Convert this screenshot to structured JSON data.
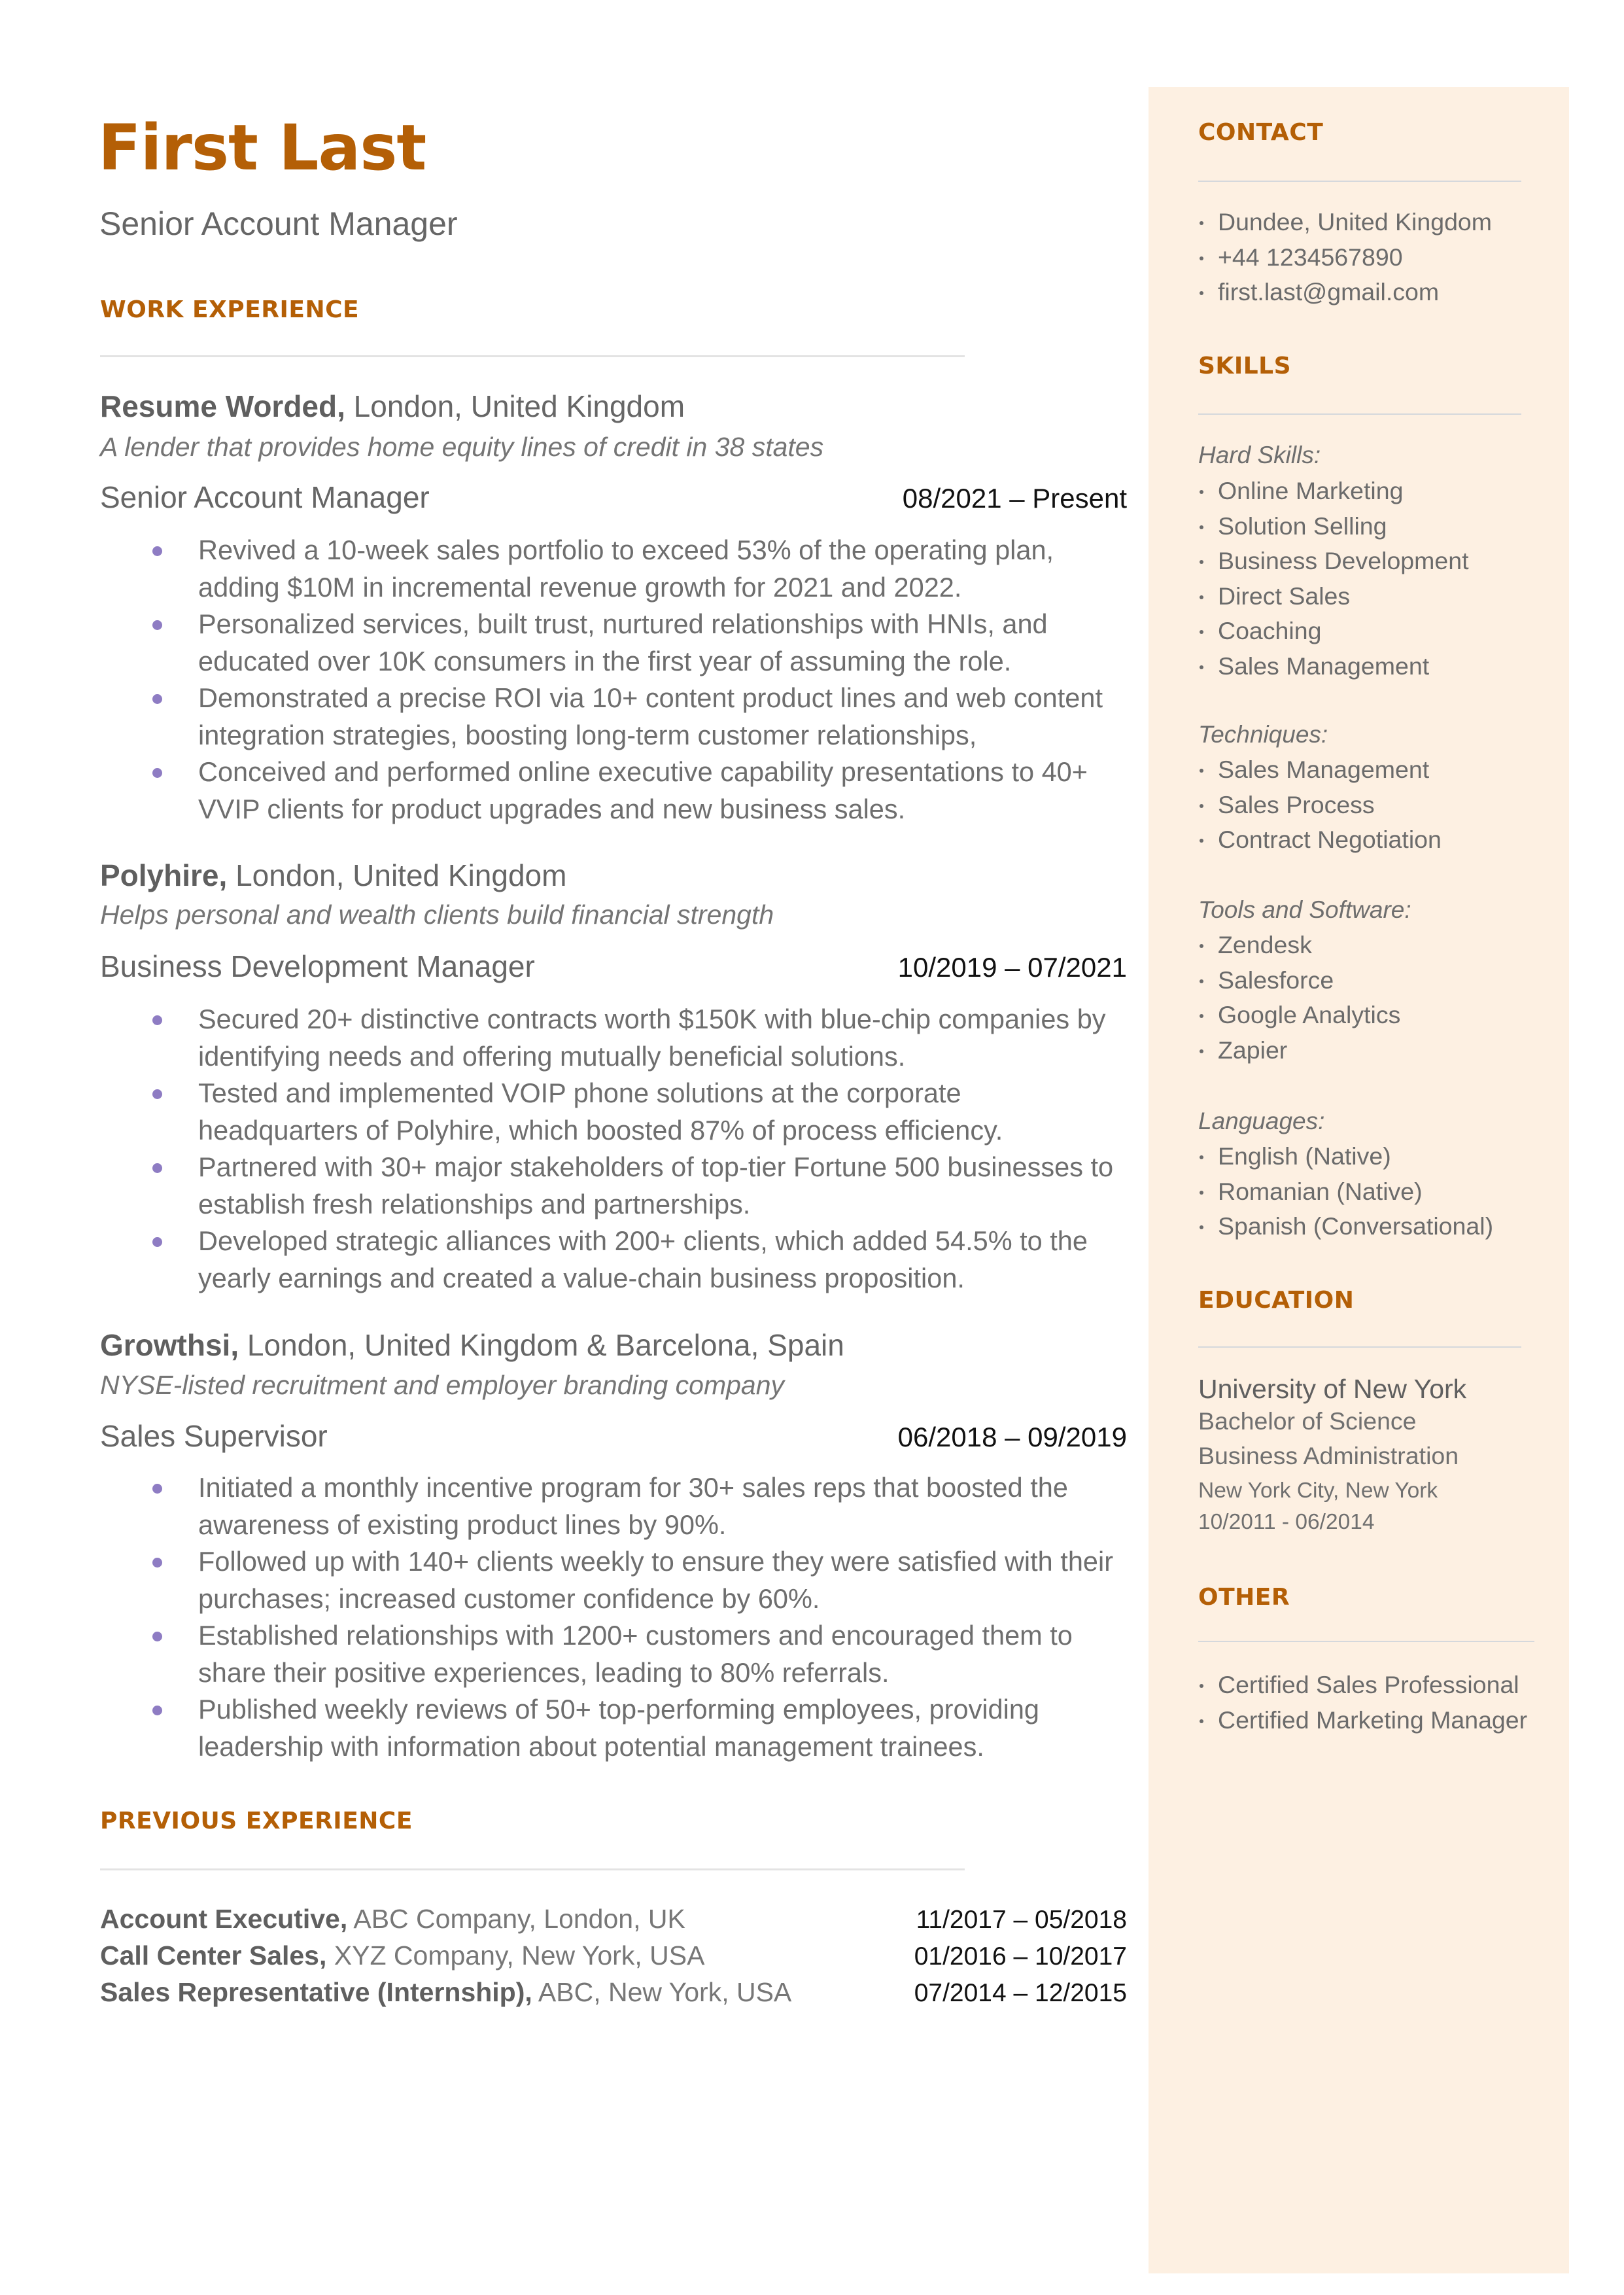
{
  "header": {
    "name": "First Last",
    "title": "Senior Account Manager"
  },
  "colors": {
    "accent": "#b45f06",
    "bullet": "#8e7cc3",
    "sidebar_bg": "#fdf0e2",
    "text": "#666666"
  },
  "work_experience": {
    "heading": "WORK EXPERIENCE",
    "jobs": [
      {
        "company": "Resume Worded,",
        "location": " London, United Kingdom",
        "tagline": "A lender that provides home equity lines of credit in 38 states",
        "role": "Senior Account Manager",
        "dates": "08/2021 – Present",
        "bullets": [
          "Revived a 10-week sales portfolio to exceed 53% of the operating plan, adding $10M in incremental revenue growth for 2021 and 2022.",
          "Personalized services, built trust, nurtured relationships with HNIs, and educated over 10K consumers in the first year of assuming the role.",
          "Demonstrated a precise ROI via 10+ content product lines and web content integration strategies, boosting long-term customer relationships,",
          "Conceived and performed online executive capability presentations to 40+ VVIP clients for product upgrades and new business sales."
        ]
      },
      {
        "company": "Polyhire,",
        "location": " London, United Kingdom",
        "tagline": "Helps personal and wealth clients build financial strength",
        "role": "Business Development Manager",
        "dates": "10/2019 – 07/2021",
        "bullets": [
          "Secured 20+ distinctive contracts worth $150K with blue-chip companies by identifying needs and offering mutually beneficial solutions.",
          "Tested and implemented VOIP phone solutions at the corporate headquarters of Polyhire, which boosted 87% of process efficiency.",
          "Partnered with 30+ major stakeholders of top-tier Fortune 500 businesses to establish fresh relationships and partnerships.",
          "Developed strategic alliances with 200+ clients, which added 54.5% to the yearly earnings and created a value-chain business proposition."
        ]
      },
      {
        "company": "Growthsi,",
        "location": " London, United Kingdom & Barcelona, Spain",
        "tagline": "NYSE-listed recruitment and employer branding company",
        "role": "Sales Supervisor",
        "dates": "06/2018 – 09/2019",
        "bullets": [
          "Initiated a monthly incentive program for 30+ sales reps that boosted the awareness of existing product lines by 90%.",
          "Followed up with 140+ clients weekly to ensure they were satisfied with their purchases; increased customer confidence by 60%.",
          "Established relationships with 1200+ customers and encouraged them to share their positive experiences, leading to 80% referrals.",
          "Published weekly reviews of 50+ top-performing employees, providing leadership with information about potential management trainees."
        ]
      }
    ]
  },
  "previous_experience": {
    "heading": "PREVIOUS EXPERIENCE",
    "items": [
      {
        "role": "Account Executive,",
        "rest": " ABC Company, London, UK",
        "dates": "11/2017 – 05/2018"
      },
      {
        "role": "Call Center Sales,",
        "rest": " XYZ Company, New York, USA",
        "dates": "01/2016 – 10/2017"
      },
      {
        "role": "Sales Representative (Internship),",
        "rest": " ABC, New York, USA",
        "dates": "07/2014 – 12/2015"
      }
    ]
  },
  "sidebar": {
    "contact": {
      "heading": "CONTACT",
      "items": [
        " Dundee, United Kingdom",
        "+44 1234567890",
        "first.last@gmail.com"
      ]
    },
    "skills": {
      "heading": "SKILLS",
      "groups": [
        {
          "label": "Hard Skills:",
          "items": [
            "Online Marketing",
            "Solution Selling",
            "Business Development",
            "Direct Sales",
            "Coaching",
            "Sales Management"
          ]
        },
        {
          "label": "Techniques:",
          "items": [
            "Sales Management",
            "Sales Process",
            "Contract Negotiation"
          ]
        },
        {
          "label": "Tools and Software:",
          "items": [
            "Zendesk",
            "Salesforce",
            "Google Analytics",
            "Zapier"
          ]
        },
        {
          "label": "Languages:",
          "items": [
            "English (Native)",
            "Romanian (Native)",
            "Spanish (Conversational)"
          ]
        }
      ]
    },
    "education": {
      "heading": "EDUCATION",
      "school": "University of New York",
      "degree": "Bachelor of Science",
      "field": "Business Administration",
      "location": "New York City, New York",
      "dates": "10/2011 - 06/2014"
    },
    "other": {
      "heading": "OTHER",
      "items": [
        "Certified Sales Professional",
        "Certified Marketing Manager"
      ]
    }
  }
}
